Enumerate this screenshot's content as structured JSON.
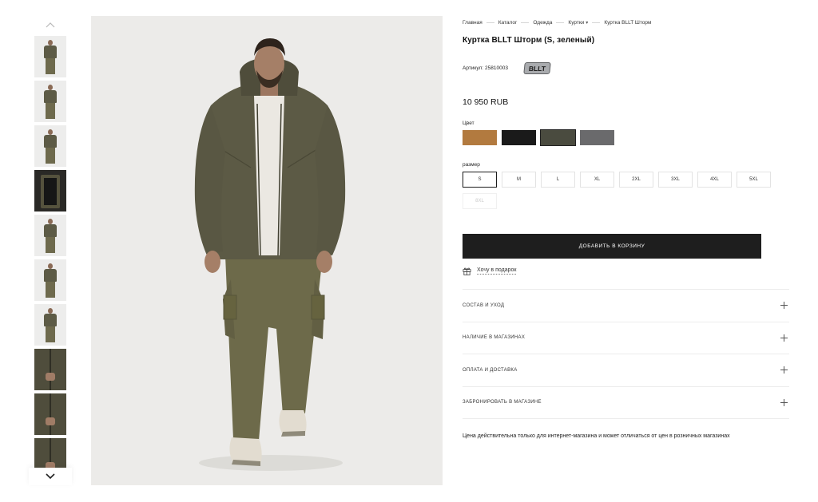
{
  "breadcrumb": [
    "Главная",
    "Каталог",
    "Одежда",
    "Куртки",
    "Куртка BLLT Шторм"
  ],
  "breadcrumb_dropdown_index": 3,
  "product": {
    "title": "Куртка BLLT Шторм (S, зеленый)",
    "article_label": "Артикул:",
    "article_value": "25810003",
    "brand_logo_text": "BLLT",
    "price": "10 950 RUB"
  },
  "color_section": {
    "label": "Цвет",
    "swatches": [
      {
        "name": "brown",
        "hex": "#b27a3f",
        "selected": false
      },
      {
        "name": "black",
        "hex": "#1a1a1a",
        "selected": false
      },
      {
        "name": "olive",
        "hex": "#4a4b3f",
        "selected": true
      },
      {
        "name": "grey",
        "hex": "#6a6a6c",
        "selected": false
      }
    ]
  },
  "size_section": {
    "label": "размер",
    "sizes": [
      {
        "label": "S",
        "state": "selected"
      },
      {
        "label": "M",
        "state": "available"
      },
      {
        "label": "L",
        "state": "available"
      },
      {
        "label": "XL",
        "state": "available"
      },
      {
        "label": "2XL",
        "state": "available"
      },
      {
        "label": "3XL",
        "state": "available"
      },
      {
        "label": "4XL",
        "state": "available"
      },
      {
        "label": "5XL",
        "state": "available"
      },
      {
        "label": "8XL",
        "state": "disabled"
      }
    ]
  },
  "actions": {
    "add_to_cart": "ДОБАВИТЬ В КОРЗИНУ",
    "gift": "Хочу в подарок"
  },
  "accordion": [
    "СОСТАВ И УХОД",
    "НАЛИЧИЕ В МАГАЗИНАХ",
    "ОПЛАТА И ДОСТАВКА",
    "ЗАБРОНИРОВАТЬ В МАГАЗИНЕ"
  ],
  "note": "Цена действительна только для интернет-магазина и может отличаться от цен в розничных магазинах",
  "thumbnails": [
    "front-full",
    "side",
    "front-half",
    "jacket-inside",
    "full-walk",
    "three-quarter",
    "front-half-2",
    "hood-detail",
    "pocket-detail",
    "sleeve-detail"
  ],
  "gallery_icons": {
    "up": "chevron-up-icon",
    "down": "chevron-down-icon"
  }
}
